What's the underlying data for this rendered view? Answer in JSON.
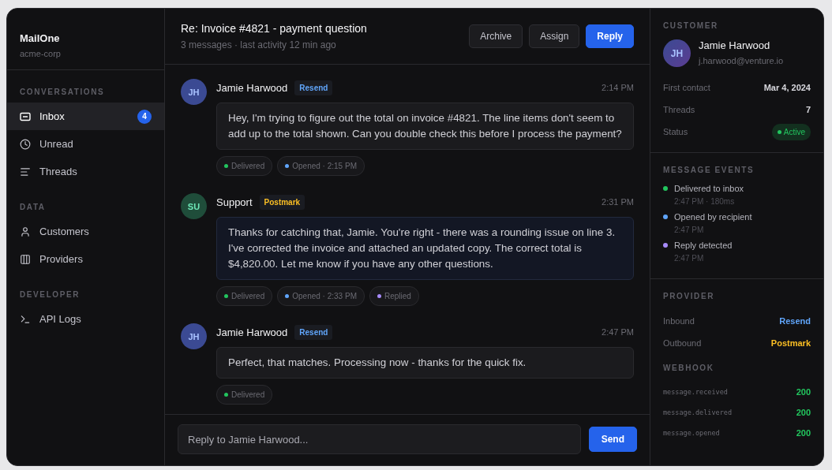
{
  "sidebar": {
    "brand": "MailOne",
    "workspace": "acme-corp",
    "sections": [
      {
        "title": "CONVERSATIONS",
        "items": [
          {
            "label": "Inbox",
            "selected": true,
            "badge": "4"
          },
          {
            "label": "Unread",
            "selected": false
          },
          {
            "label": "Threads",
            "selected": false
          }
        ]
      },
      {
        "title": "DATA",
        "items": [
          {
            "label": "Customers",
            "selected": false
          },
          {
            "label": "Providers",
            "selected": false
          }
        ]
      },
      {
        "title": "DEVELOPER",
        "items": [
          {
            "label": "API Logs",
            "selected": false
          }
        ]
      }
    ]
  },
  "thread": {
    "title": "Re: Invoice #4821 - payment question",
    "meta": "3 messages · last activity 12 min ago",
    "actions": [
      {
        "label": "Archive",
        "kind": "secondary"
      },
      {
        "label": "Assign",
        "kind": "secondary"
      },
      {
        "label": "Reply",
        "kind": "primary"
      }
    ],
    "messages": [
      {
        "kind": "inbound",
        "initials": "JH",
        "sender": "Jamie Harwood",
        "provider": {
          "label": "Resend",
          "color": "#60a5fa"
        },
        "time": "2:14 PM",
        "body": "Hey, I'm trying to figure out the total on invoice #4821. The line items don't seem to add up to the total shown. Can you double check this before I process the payment?",
        "events": [
          {
            "label": "Delivered",
            "color": "#22c55e"
          },
          {
            "label": "Opened · 2:15 PM",
            "color": "#60a5fa"
          }
        ]
      },
      {
        "kind": "outbound",
        "initials": "SU",
        "sender": "Support",
        "provider": {
          "label": "Postmark",
          "color": "#fbbf24"
        },
        "time": "2:31 PM",
        "body": "Thanks for catching that, Jamie. You're right - there was a rounding issue on line 3. I've corrected the invoice and attached an updated copy. The correct total is $4,820.00. Let me know if you have any other questions.",
        "events": [
          {
            "label": "Delivered",
            "color": "#22c55e"
          },
          {
            "label": "Opened · 2:33 PM",
            "color": "#60a5fa"
          },
          {
            "label": "Replied",
            "color": "#a78bfa"
          }
        ]
      },
      {
        "kind": "inbound",
        "initials": "JH",
        "sender": "Jamie Harwood",
        "provider": {
          "label": "Resend",
          "color": "#60a5fa"
        },
        "time": "2:47 PM",
        "body": "Perfect, that matches. Processing now - thanks for the quick fix.",
        "events": [
          {
            "label": "Delivered",
            "color": "#22c55e"
          }
        ]
      }
    ],
    "composer": {
      "placeholder": "Reply to Jamie Harwood...",
      "send": "Send"
    }
  },
  "details": {
    "customer": {
      "title": "CUSTOMER",
      "initials": "JH",
      "name": "Jamie Harwood",
      "email": "j.harwood@venture.io",
      "fields": [
        {
          "label": "First contact",
          "value": "Mar 4, 2024"
        },
        {
          "label": "Threads",
          "value": "7"
        }
      ],
      "status": {
        "label": "Status",
        "value": "Active",
        "color": "#22c55e"
      }
    },
    "events": {
      "title": "MESSAGE EVENTS",
      "items": [
        {
          "label": "Delivered to inbox",
          "time": "2:47 PM · 180ms",
          "color": "#22c55e"
        },
        {
          "label": "Opened by recipient",
          "time": "2:47 PM",
          "color": "#60a5fa"
        },
        {
          "label": "Reply detected",
          "time": "2:47 PM",
          "color": "#a78bfa"
        }
      ]
    },
    "provider": {
      "title": "PROVIDER",
      "rows": [
        {
          "label": "Inbound",
          "value": "Resend",
          "color": "#60a5fa"
        },
        {
          "label": "Outbound",
          "value": "Postmark",
          "color": "#fbbf24"
        }
      ]
    },
    "webhook": {
      "title": "WEBHOOK",
      "rows": [
        {
          "event": "message.received",
          "status": "200"
        },
        {
          "event": "message.delivered",
          "status": "200"
        },
        {
          "event": "message.opened",
          "status": "200"
        }
      ]
    }
  }
}
